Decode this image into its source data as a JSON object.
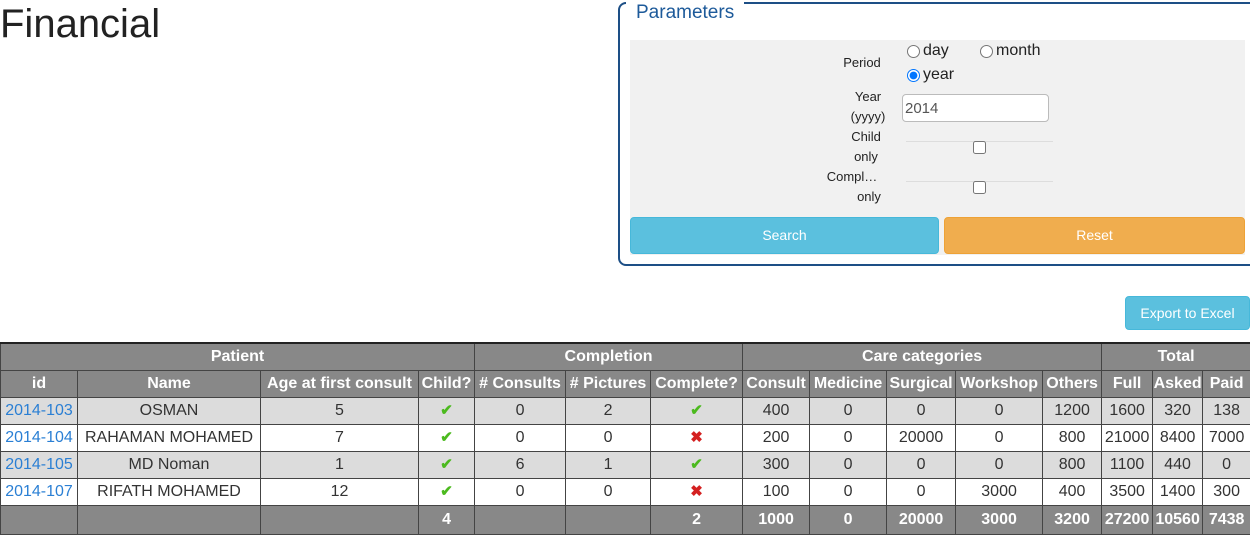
{
  "page": {
    "title": "Financial"
  },
  "params": {
    "legend": "Parameters",
    "period_label": "Period",
    "period_options": [
      "day",
      "month",
      "year"
    ],
    "period_selected": "year",
    "year_label_1": "Year",
    "year_label_2": "(yyyy)",
    "year_value": "2014",
    "child_label_1": "Child",
    "child_label_2": "only",
    "child_checked": false,
    "compl_label_1": "Compl…",
    "compl_label_2": "only",
    "compl_checked": false,
    "search_label": "Search",
    "reset_label": "Reset"
  },
  "export_label": "Export to Excel",
  "table": {
    "groups": [
      "Patient",
      "Completion",
      "Care categories",
      "Total"
    ],
    "columns": [
      "id",
      "Name",
      "Age at first consult",
      "Child?",
      "# Consults",
      "# Pictures",
      "Complete?",
      "Consult",
      "Medicine",
      "Surgical",
      "Workshop",
      "Others",
      "Full",
      "Asked",
      "Paid"
    ],
    "rows": [
      {
        "id": "2014-103",
        "name": "OSMAN",
        "age": "5",
        "child": "check-icon",
        "consults": "0",
        "pictures": "2",
        "complete": "check-icon",
        "consult": "400",
        "medicine": "0",
        "surgical": "0",
        "workshop": "0",
        "others": "1200",
        "full": "1600",
        "asked": "320",
        "paid": "138"
      },
      {
        "id": "2014-104",
        "name": "RAHAMAN MOHAMED",
        "age": "7",
        "child": "check-icon",
        "consults": "0",
        "pictures": "0",
        "complete": "cross-icon",
        "consult": "200",
        "medicine": "0",
        "surgical": "20000",
        "workshop": "0",
        "others": "800",
        "full": "21000",
        "asked": "8400",
        "paid": "7000"
      },
      {
        "id": "2014-105",
        "name": "MD Noman",
        "age": "1",
        "child": "check-icon",
        "consults": "6",
        "pictures": "1",
        "complete": "check-icon",
        "consult": "300",
        "medicine": "0",
        "surgical": "0",
        "workshop": "0",
        "others": "800",
        "full": "1100",
        "asked": "440",
        "paid": "0"
      },
      {
        "id": "2014-107",
        "name": "RIFATH MOHAMED",
        "age": "12",
        "child": "check-icon",
        "consults": "0",
        "pictures": "0",
        "complete": "cross-icon",
        "consult": "100",
        "medicine": "0",
        "surgical": "0",
        "workshop": "3000",
        "others": "400",
        "full": "3500",
        "asked": "1400",
        "paid": "300"
      }
    ],
    "totals": {
      "child": "4",
      "complete": "2",
      "consult": "1000",
      "medicine": "0",
      "surgical": "20000",
      "workshop": "3000",
      "others": "3200",
      "full": "27200",
      "asked": "10560",
      "paid": "7438"
    }
  },
  "colors": {
    "check": "#4cba1f",
    "cross": "#d42020",
    "header_bg": "#888888",
    "link": "#2a7fd4"
  }
}
